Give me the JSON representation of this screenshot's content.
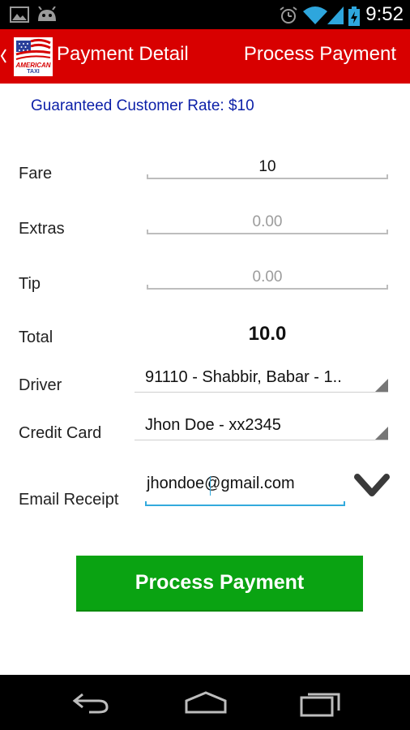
{
  "status_bar": {
    "time": "9:52",
    "icons": [
      "gallery-icon",
      "android-icon",
      "alarm-icon",
      "wifi-icon",
      "signal-icon",
      "battery-icon"
    ]
  },
  "action_bar": {
    "title": "Payment Detail",
    "action_label": "Process Payment",
    "logo_text": "AMERICAN TAXI",
    "background_color": "#d80000"
  },
  "form": {
    "guaranteed_rate": "Guaranteed Customer Rate: $10",
    "fare": {
      "label": "Fare",
      "value": "10"
    },
    "extras": {
      "label": "Extras",
      "placeholder": "0.00"
    },
    "tip": {
      "label": "Tip",
      "placeholder": "0.00"
    },
    "total": {
      "label": "Total",
      "value": "10.0"
    },
    "driver": {
      "label": "Driver",
      "value": "91110 - Shabbir, Babar -  1.."
    },
    "credit_card": {
      "label": "Credit Card",
      "value": "Jhon Doe - xx2345"
    },
    "email_receipt": {
      "label": "Email Receipt",
      "value": "jhondoe@gmail.com"
    }
  },
  "submit": {
    "label": "Process Payment",
    "color": "#0aa312"
  },
  "nav_bar": {
    "buttons": [
      "back-icon",
      "home-icon",
      "recents-icon"
    ]
  }
}
